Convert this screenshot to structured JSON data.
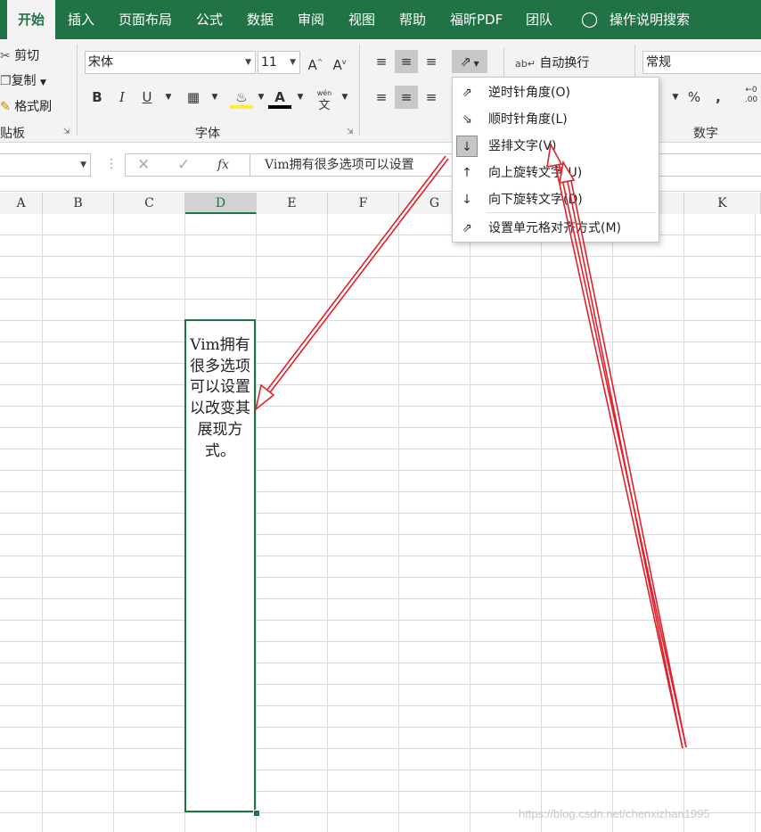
{
  "tabs": [
    "开始",
    "插入",
    "页面布局",
    "公式",
    "数据",
    "审阅",
    "视图",
    "帮助",
    "福昕PDF",
    "团队",
    "操作说明搜索"
  ],
  "clipboard": {
    "cut": "剪切",
    "copy": "复制",
    "format_painter": "格式刷",
    "group_label": "贴板"
  },
  "font": {
    "name": "宋体",
    "size": "11",
    "bold": "B",
    "italic": "I",
    "underline": "U",
    "wen": "wén",
    "wen_char": "文",
    "group_label": "字体"
  },
  "alignment": {
    "wrap_text": "自动换行"
  },
  "number": {
    "format": "常规",
    "percent": "%",
    "comma": ",",
    "group_label": "数字"
  },
  "formula_bar": {
    "fx": "fx",
    "content": "Vim拥有很多选项可以设置"
  },
  "columns": [
    "A",
    "B",
    "C",
    "D",
    "E",
    "F",
    "G",
    "K"
  ],
  "selected_column": "D",
  "cell_text": "Vim拥有很多选项可以设置以改变其展现方式。",
  "orientation_menu": [
    {
      "label": "逆时针角度(O)",
      "icon": "rotate-counterclockwise-icon"
    },
    {
      "label": "顺时针角度(L)",
      "icon": "rotate-clockwise-icon"
    },
    {
      "label": "竖排文字(V)",
      "icon": "vertical-text-icon",
      "selected": true
    },
    {
      "label": "向上旋转文字(U)",
      "icon": "rotate-up-icon"
    },
    {
      "label": "向下旋转文字(D)",
      "icon": "rotate-down-icon"
    },
    {
      "label": "设置单元格对齐方式(M)",
      "icon": "format-alignment-icon"
    }
  ],
  "watermark": "https://blog.csdn.net/chenxizhan1995",
  "colors": {
    "excel_green": "#217346",
    "annotation_red": "#e0202a"
  }
}
